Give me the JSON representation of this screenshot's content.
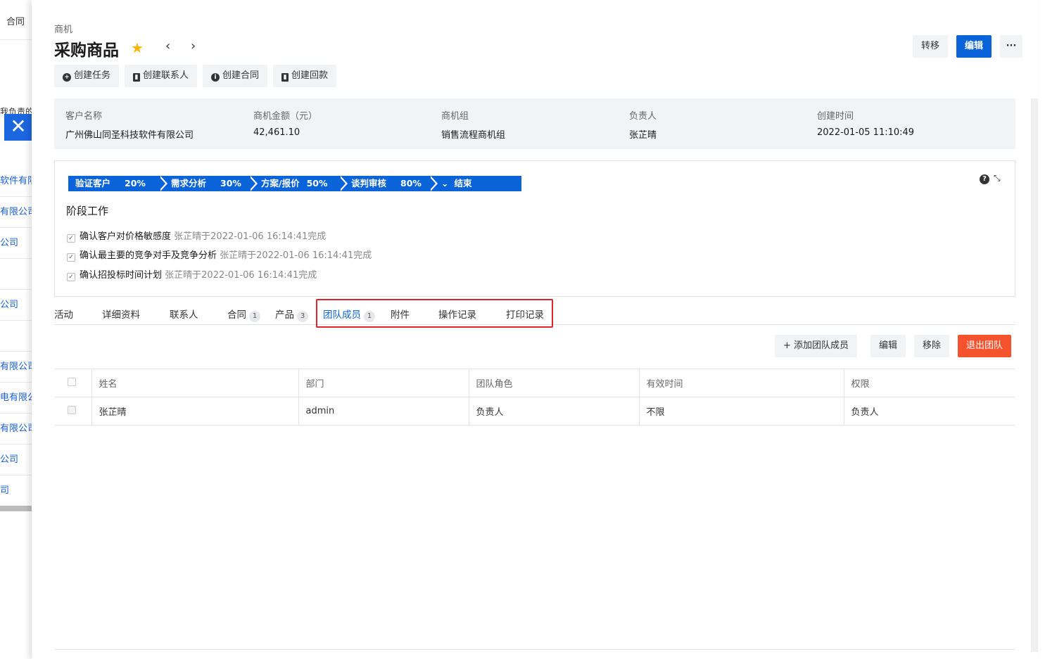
{
  "background_list": {
    "top_label": "合同",
    "partial_label": "我负责的",
    "rows": [
      "软件有限",
      "有限公司",
      "公司",
      "",
      "公司",
      "",
      "有限公司",
      "电有限公",
      "有限公司",
      "公司",
      "司"
    ]
  },
  "header": {
    "breadcrumb": "商机",
    "title": "采购商品",
    "star": "★",
    "prev": "‹",
    "next": "›",
    "transfer_label": "转移",
    "edit_label": "编辑",
    "more_label": "···",
    "close": "✕"
  },
  "actions": [
    {
      "icon": "+",
      "label": "创建任务"
    },
    {
      "icon": "▮",
      "label": "创建联系人"
    },
    {
      "icon": "i",
      "label": "创建合同"
    },
    {
      "icon": "▮",
      "label": "创建回款"
    }
  ],
  "summary": [
    {
      "label": "客户名称",
      "value": "广州佛山同圣科技软件有限公司"
    },
    {
      "label": "商机金额（元）",
      "value": "42,461.10"
    },
    {
      "label": "商机组",
      "value": "销售流程商机组"
    },
    {
      "label": "负责人",
      "value": "张芷晴"
    },
    {
      "label": "创建时间",
      "value": "2022-01-05 11:10:49"
    }
  ],
  "stages": [
    {
      "name": "验证客户",
      "percent": "20%"
    },
    {
      "name": "需求分析",
      "percent": "30%"
    },
    {
      "name": "方案/报价",
      "percent": "50%"
    },
    {
      "name": "谈判审核",
      "percent": "80%"
    },
    {
      "name": "结束",
      "percent": ""
    }
  ],
  "stage_end_chevron": "⌄",
  "help_icon": "?",
  "collapse_icon": "⤡",
  "stage_work": {
    "title": "阶段工作",
    "tasks": [
      {
        "text": "确认客户对价格敏感度",
        "done_by": "张芷晴于2022-01-06 16:14:41完成"
      },
      {
        "text": "确认最主要的竞争对手及竞争分析",
        "done_by": "张芷晴于2022-01-06 16:14:41完成"
      },
      {
        "text": "确认招投标时间计划",
        "done_by": "张芷晴于2022-01-06 16:14:41完成"
      }
    ]
  },
  "tabs": [
    {
      "label": "活动",
      "badge": ""
    },
    {
      "label": "详细资料",
      "badge": ""
    },
    {
      "label": "联系人",
      "badge": ""
    },
    {
      "label": "合同",
      "badge": "1"
    },
    {
      "label": "产品",
      "badge": "3"
    },
    {
      "label": "团队成员",
      "badge": "1"
    },
    {
      "label": "附件",
      "badge": ""
    },
    {
      "label": "操作记录",
      "badge": ""
    },
    {
      "label": "打印记录",
      "badge": ""
    }
  ],
  "active_tab": "团队成员",
  "team_actions": {
    "add_label": "+ 添加团队成员",
    "edit_label": "编辑",
    "remove_label": "移除",
    "quit_label": "退出团队"
  },
  "team_table": {
    "columns": [
      "姓名",
      "部门",
      "团队角色",
      "有效时间",
      "权限"
    ],
    "rows": [
      [
        "张芷晴",
        "admin",
        "负责人",
        "不限",
        "负责人"
      ]
    ]
  },
  "colors": {
    "primary": "#0a63d8",
    "danger": "#f5532d",
    "highlight": "#e0242b",
    "star": "#f7b500"
  }
}
